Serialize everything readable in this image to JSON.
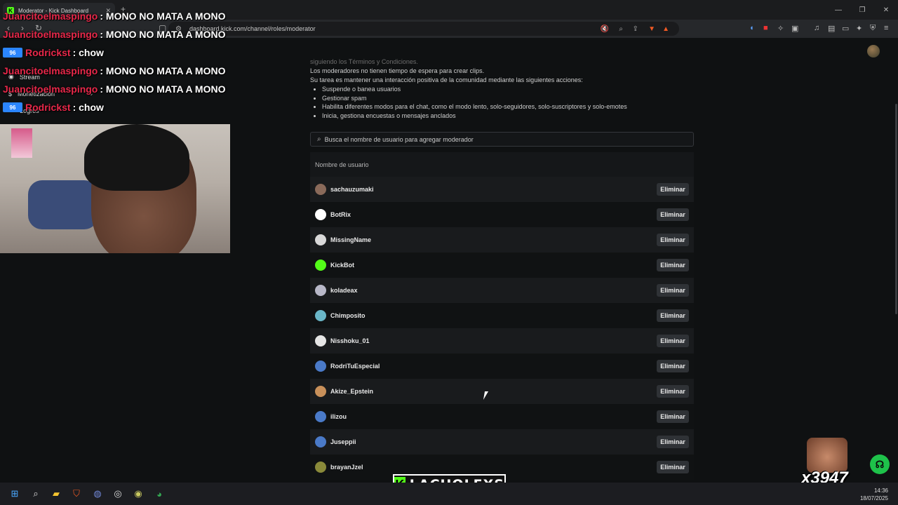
{
  "browser": {
    "tab_title": "Moderator - Kick Dashboard",
    "tab_favicon": "K",
    "url": "dashboard.kick.com/channel/roles/moderator"
  },
  "sidebar": {
    "items": [
      {
        "label": "Stream",
        "icon": "broadcast-icon"
      },
      {
        "label": "Monetización",
        "icon": "dollar-icon"
      },
      {
        "label": "Logros",
        "icon": "trophy-icon"
      }
    ]
  },
  "intro": {
    "line0": "siguiendo los Términos y Condiciones.",
    "line1": "Los moderadores no tienen tiempo de espera para crear clips.",
    "line2": "Su tarea es mantener una interacción positiva de la comunidad mediante las siguientes acciones:",
    "actions": [
      "Suspende o banea usuarios",
      "Gestionar spam",
      "Habilita diferentes modos para el chat, como el modo lento, solo-seguidores, solo-suscriptores y solo-emotes",
      "Inicia, gestiona encuestas o mensajes anclados"
    ]
  },
  "search": {
    "placeholder": "Busca el nombre de usuario para agregar moderador"
  },
  "table": {
    "header": "Nombre de usuario",
    "remove_label": "Eliminar",
    "rows": [
      {
        "username": "sachauzumaki",
        "avatar_color": "#8a6a5a"
      },
      {
        "username": "BotRix",
        "avatar_color": "#ffffff"
      },
      {
        "username": "MissingName",
        "avatar_color": "#d9d9d9"
      },
      {
        "username": "KickBot",
        "avatar_color": "#53fc18"
      },
      {
        "username": "koladeax",
        "avatar_color": "#b8b8c8"
      },
      {
        "username": "Chimposito",
        "avatar_color": "#6ab6c8"
      },
      {
        "username": "Nisshoku_01",
        "avatar_color": "#e6e6e6"
      },
      {
        "username": "RodriTuEspecial",
        "avatar_color": "#4a7ac8"
      },
      {
        "username": "Akize_Epstein",
        "avatar_color": "#c8905a"
      },
      {
        "username": "ilizou",
        "avatar_color": "#4a7ac8"
      },
      {
        "username": "Juseppii",
        "avatar_color": "#4a7ac8"
      },
      {
        "username": "brayanJzel",
        "avatar_color": "#8a8a3a"
      }
    ]
  },
  "overlay": {
    "chat": [
      {
        "user": "Juancitoelmaspingo",
        "msg": ": MONO NO MATA A MONO",
        "badge": ""
      },
      {
        "user": "Juancitoelmaspingo",
        "msg": ": MONO NO MATA A MONO",
        "badge": ""
      },
      {
        "user": "Rodrickst",
        "msg": ": chow",
        "badge": "96"
      },
      {
        "user": "Juancitoelmaspingo",
        "msg": ": MONO NO MATA A MONO",
        "badge": ""
      },
      {
        "user": "Juancitoelmaspingo",
        "msg": ": MONO NO MATA A MONO",
        "badge": ""
      },
      {
        "user": "Rodrickst",
        "msg": ": chow",
        "badge": "96"
      }
    ],
    "logo_text": "LACHOLEXS",
    "sub_count": "x3947"
  },
  "taskbar": {
    "time": "14:36",
    "date": "18/07/2025"
  }
}
